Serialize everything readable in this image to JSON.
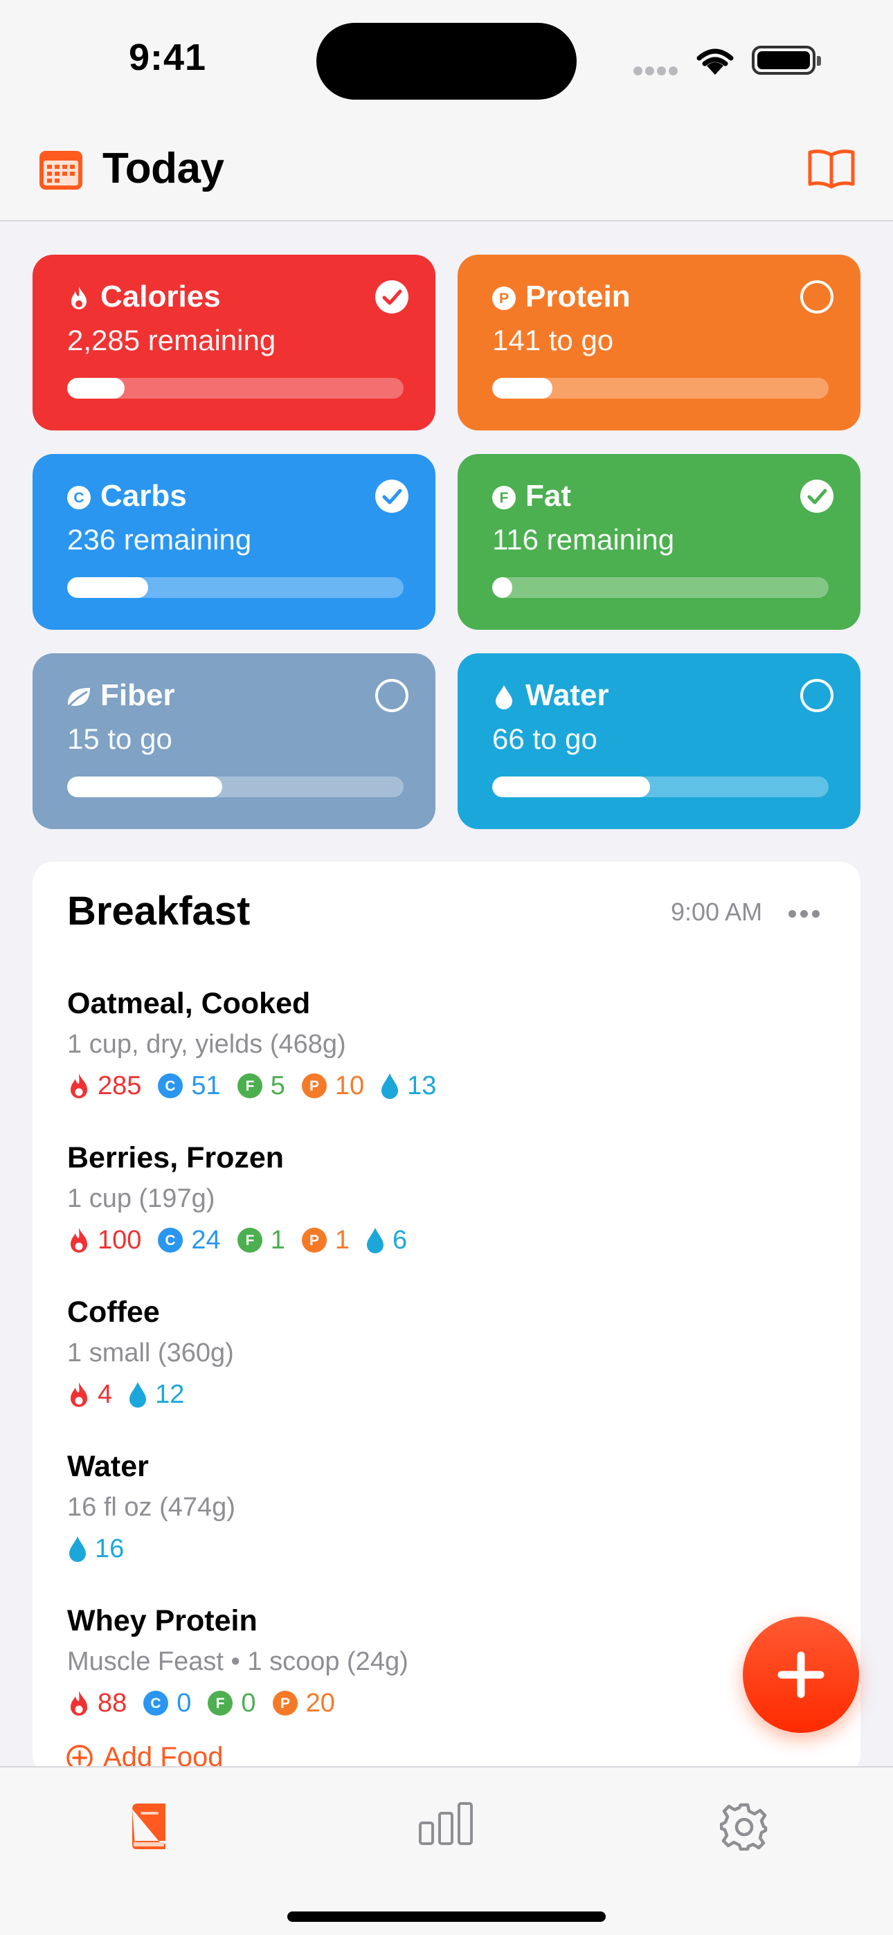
{
  "status_bar": {
    "time": "9:41"
  },
  "header": {
    "title": "Today",
    "calendar_icon": "calendar-icon",
    "book_icon": "book-icon"
  },
  "colors": {
    "accent": "#ff5a1f",
    "calories": "#f03232",
    "protein": "#f57a28",
    "carbs": "#2a96f0",
    "fat": "#4caf50",
    "fiber": "#7fa2c5",
    "water": "#1ca7db"
  },
  "goals": [
    {
      "label": "Calories",
      "subtitle": "2,285 remaining",
      "progress": 0.17,
      "checked": true,
      "icon": "flame-icon"
    },
    {
      "label": "Protein",
      "subtitle": "141 to go",
      "progress": 0.18,
      "checked": false,
      "icon": "protein-badge-icon"
    },
    {
      "label": "Carbs",
      "subtitle": "236 remaining",
      "progress": 0.24,
      "checked": true,
      "icon": "carbs-badge-icon"
    },
    {
      "label": "Fat",
      "subtitle": "116 remaining",
      "progress": 0.06,
      "checked": true,
      "icon": "fat-badge-icon"
    },
    {
      "label": "Fiber",
      "subtitle": "15 to go",
      "progress": 0.46,
      "checked": false,
      "icon": "leaf-icon"
    },
    {
      "label": "Water",
      "subtitle": "66 to go",
      "progress": 0.47,
      "checked": false,
      "icon": "water-drop-icon"
    }
  ],
  "meal": {
    "title": "Breakfast",
    "time": "9:00 AM",
    "foods": [
      {
        "name": "Oatmeal, Cooked",
        "serving": "1 cup, dry, yields (468g)",
        "nutrients": {
          "calories": "285",
          "carbs": "51",
          "fat": "5",
          "protein": "10",
          "water": "13"
        }
      },
      {
        "name": "Berries, Frozen",
        "serving": "1 cup (197g)",
        "nutrients": {
          "calories": "100",
          "carbs": "24",
          "fat": "1",
          "protein": "1",
          "water": "6"
        }
      },
      {
        "name": "Coffee",
        "serving": "1 small (360g)",
        "nutrients": {
          "calories": "4",
          "water": "12"
        }
      },
      {
        "name": "Water",
        "serving": "16 fl oz (474g)",
        "nutrients": {
          "water": "16"
        }
      },
      {
        "name": "Whey Protein",
        "serving": "Muscle Feast • 1 scoop (24g)",
        "nutrients": {
          "calories": "88",
          "carbs": "0",
          "fat": "0",
          "protein": "20"
        }
      }
    ],
    "add_food_label": "Add Food"
  },
  "tabs": [
    {
      "icon": "journal-book-icon",
      "active": true
    },
    {
      "icon": "bar-chart-icon",
      "active": false
    },
    {
      "icon": "gear-icon",
      "active": false
    }
  ]
}
